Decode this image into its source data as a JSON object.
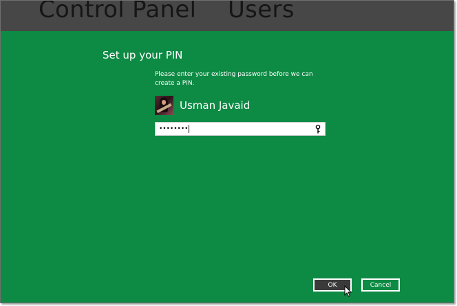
{
  "header": {
    "crumbs": [
      "Control Panel",
      "Users"
    ]
  },
  "dialog": {
    "title": "Set up your PIN",
    "instruction": "Please enter your existing password before we can create a PIN.",
    "user": {
      "name": "Usman Javaid"
    },
    "password": {
      "value": "••••••••"
    },
    "buttons": {
      "ok_label": "OK",
      "cancel_label": "Cancel"
    }
  },
  "colors": {
    "background": "#0d8a44",
    "header": "#474747",
    "header_text": "#161616",
    "ok_button": "#3a3a3a"
  },
  "icons": {
    "password_reveal": "eye-reveal-icon",
    "pointer": "mouse-cursor-icon"
  }
}
